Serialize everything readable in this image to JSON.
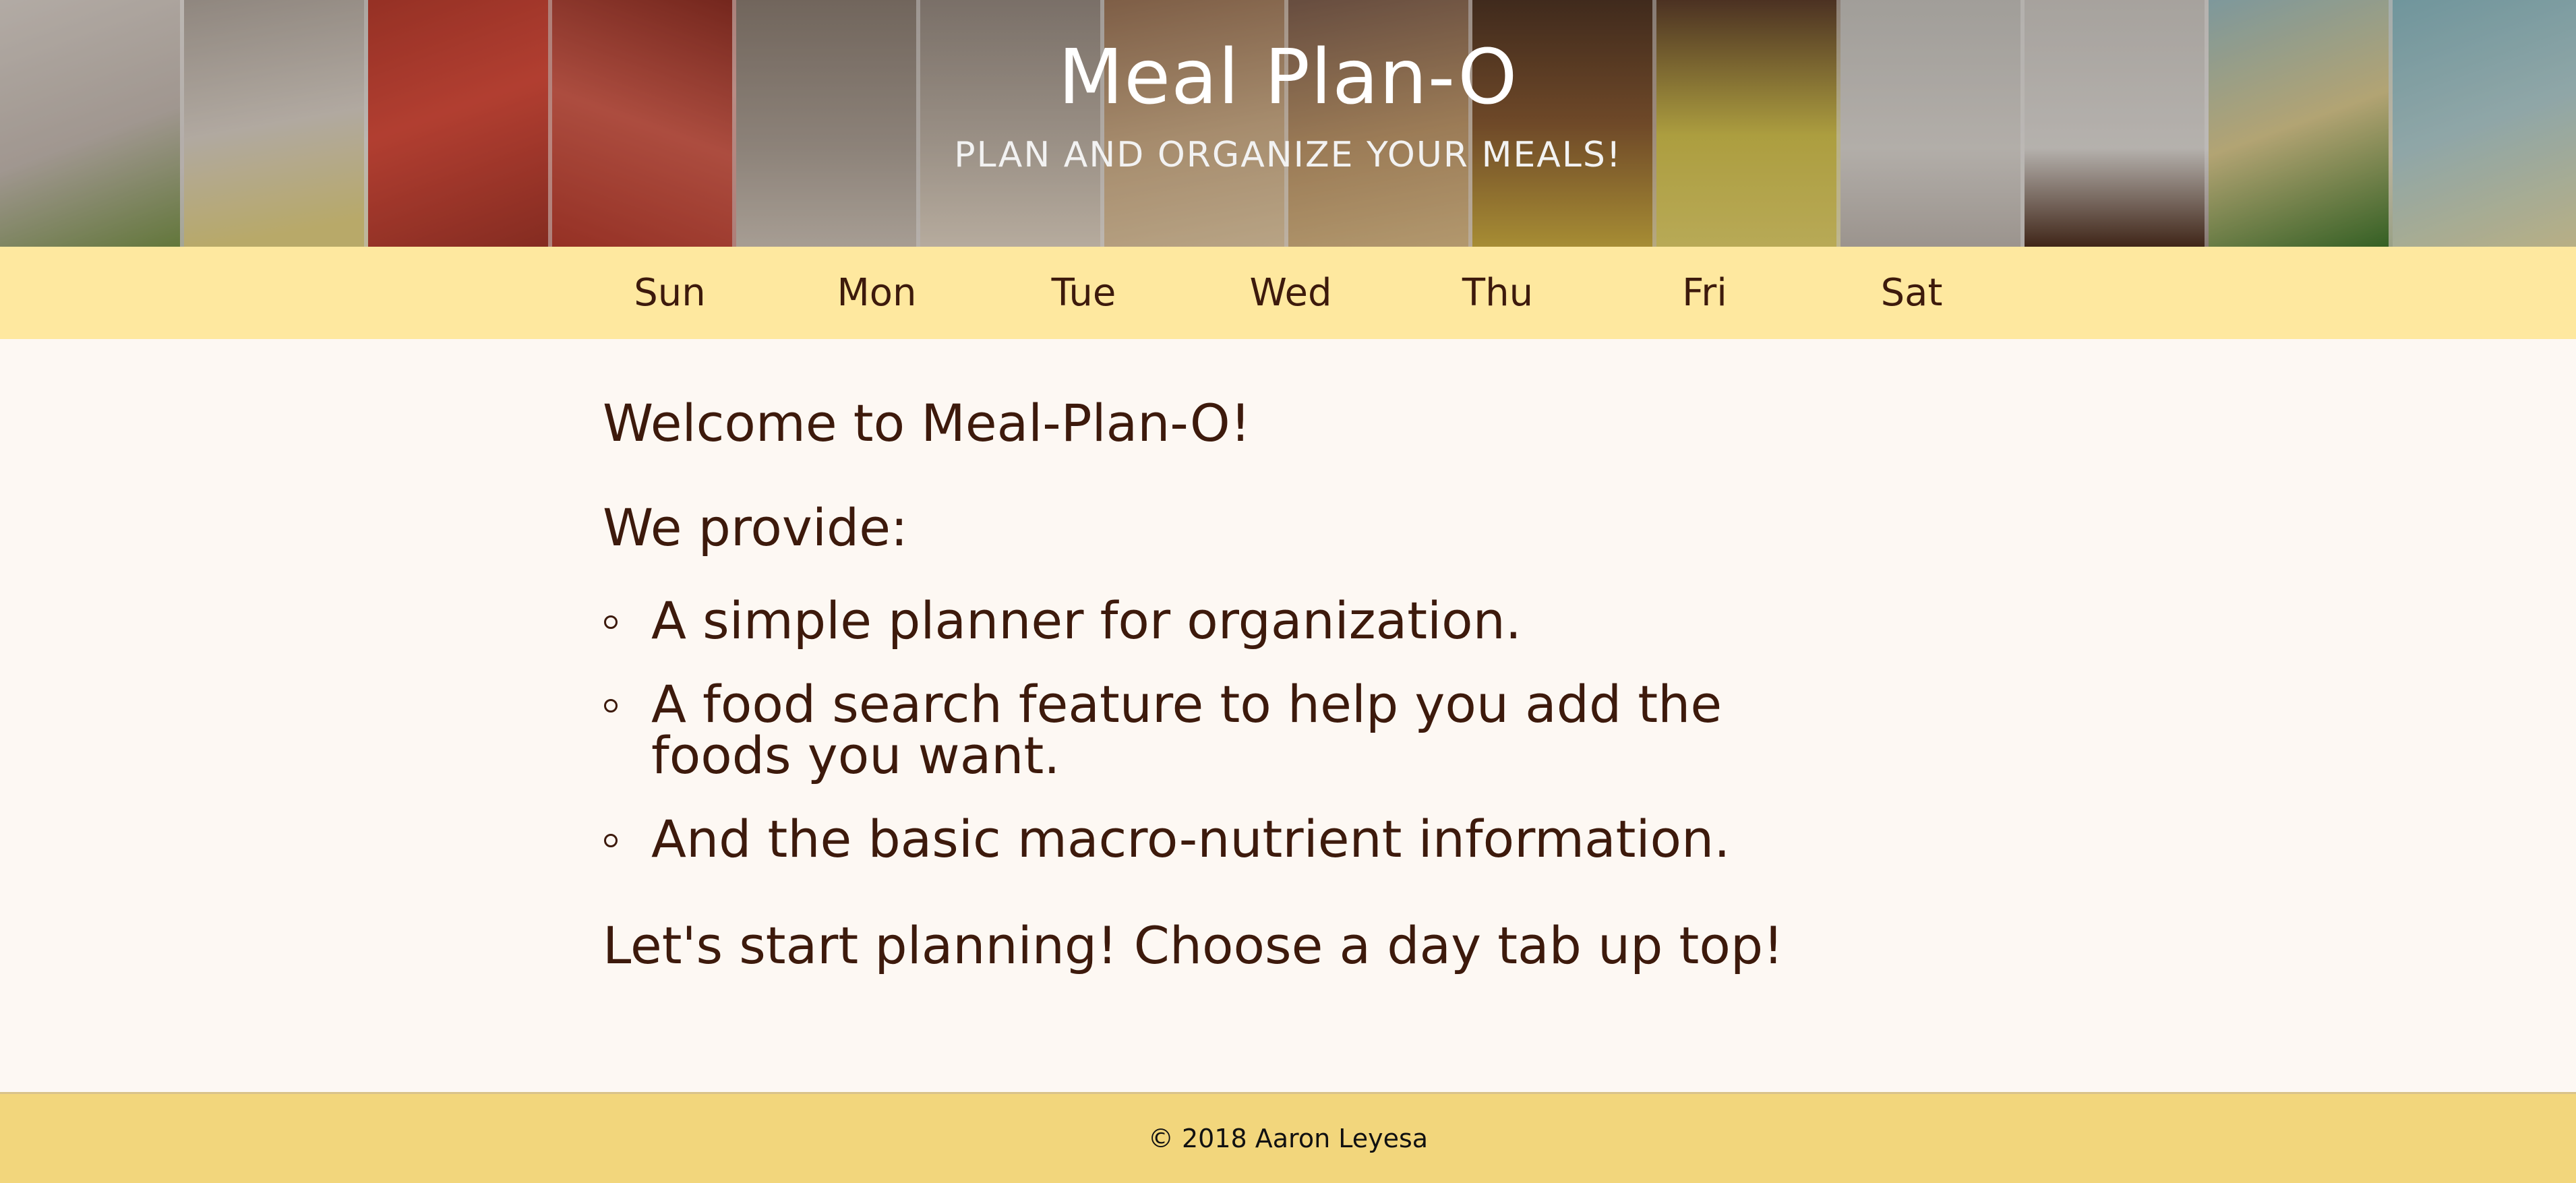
{
  "header": {
    "title": "Meal Plan-O",
    "subtitle": "PLAN AND ORGANIZE YOUR MEALS!"
  },
  "nav": {
    "tabs": [
      {
        "label": "Sun"
      },
      {
        "label": "Mon"
      },
      {
        "label": "Tue"
      },
      {
        "label": "Wed"
      },
      {
        "label": "Thu"
      },
      {
        "label": "Fri"
      },
      {
        "label": "Sat"
      }
    ]
  },
  "main": {
    "welcome": "Welcome to Meal-Plan-O!",
    "provide_heading": "We provide:",
    "features": [
      "A simple planner for organization.",
      "A food search feature to help you add the foods you want.",
      "And the basic macro-nutrient information."
    ],
    "call_to_action": "Let's start planning! Choose a day tab up top!"
  },
  "footer": {
    "copyright": "© 2018 Aaron Leyesa"
  },
  "colors": {
    "nav_bg": "#fee89f",
    "footer_bg": "#f2d67c",
    "page_bg": "#fdf8f3",
    "text": "#3d1a0c"
  }
}
